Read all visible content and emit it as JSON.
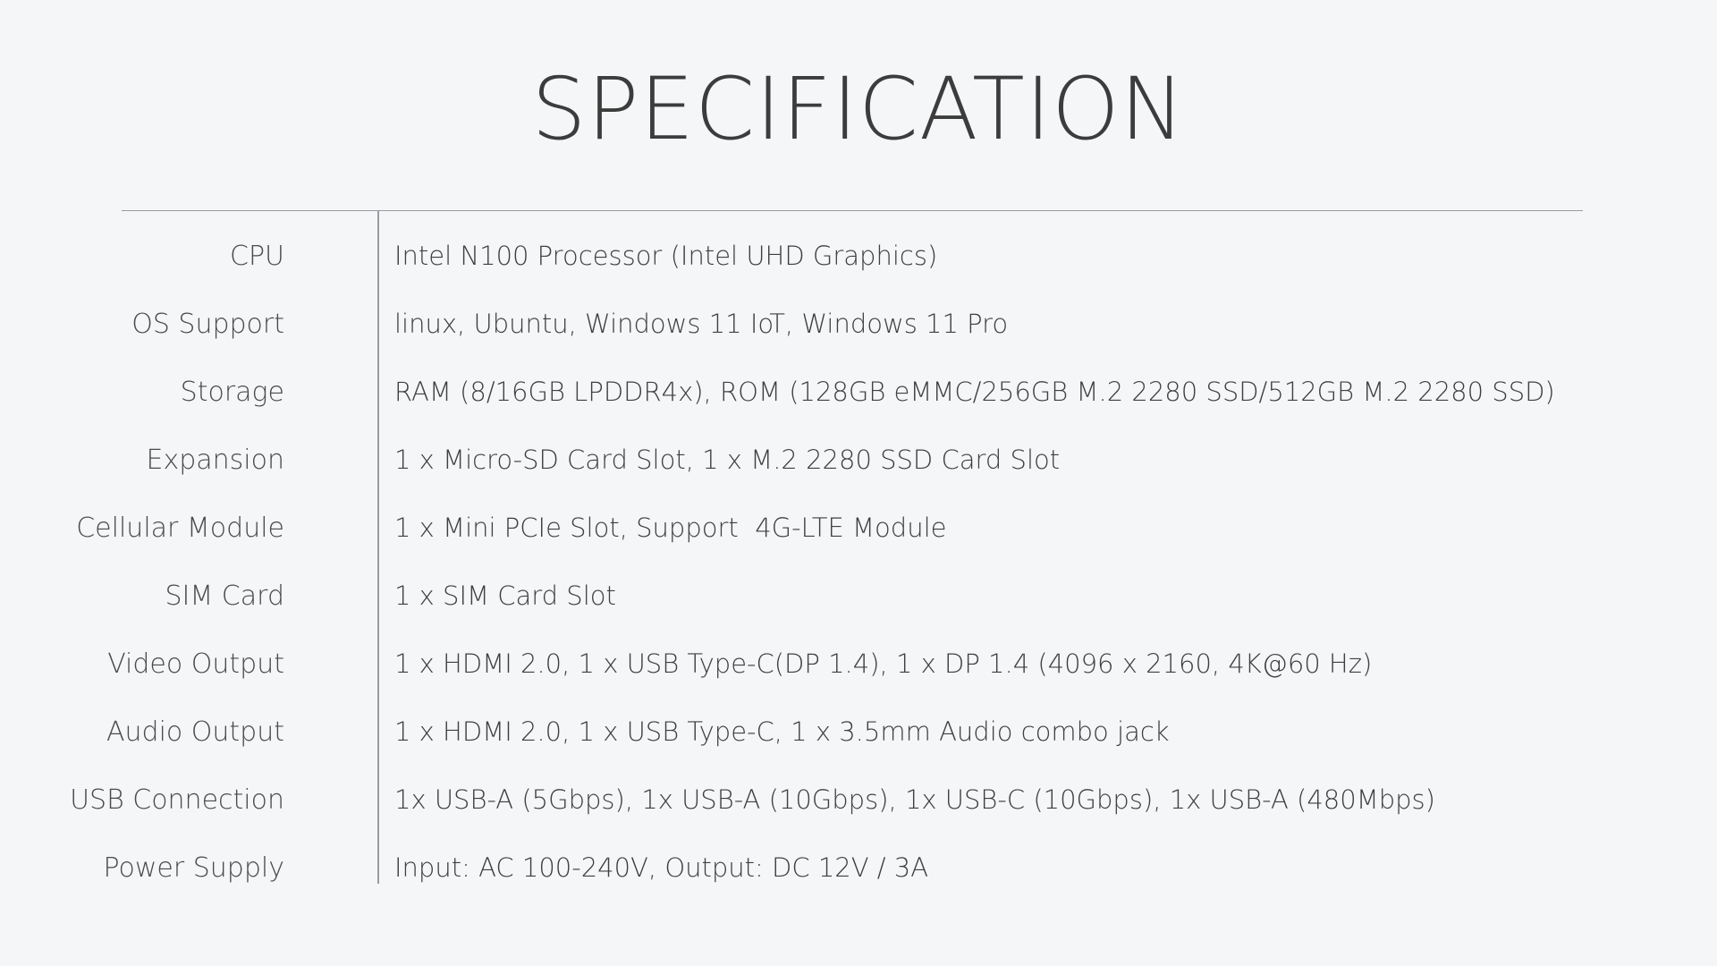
{
  "document": {
    "title": "SPECIFICATION",
    "accent_line_color": "#9a9ba0",
    "background_color": "#f5f6f7",
    "text_color": "#3f3f43"
  },
  "spec": {
    "rows": [
      {
        "label": "CPU",
        "value": "Intel N100 Processor (Intel UHD Graphics)"
      },
      {
        "label": "OS Support",
        "value": "linux, Ubuntu, Windows 11 IoT, Windows 11 Pro"
      },
      {
        "label": "Storage",
        "value": "RAM (8/16GB LPDDR4x), ROM (128GB eMMC/256GB M.2 2280 SSD/512GB M.2 2280 SSD)"
      },
      {
        "label": "Expansion",
        "value": "1 x Micro-SD Card Slot, 1 x M.2 2280 SSD Card Slot"
      },
      {
        "label": "Cellular Module",
        "value": "1 x Mini PCIe Slot, Support  4G-LTE Module"
      },
      {
        "label": "SIM Card",
        "value": "1 x SIM Card Slot"
      },
      {
        "label": "Video Output",
        "value": "1 x HDMI 2.0, 1 x USB Type-C(DP 1.4), 1 x DP 1.4 (4096 x 2160, 4K@60 Hz)"
      },
      {
        "label": "Audio Output",
        "value": "1 x HDMI 2.0, 1 x USB Type-C, 1 x 3.5mm Audio combo jack"
      },
      {
        "label": "USB Connection",
        "value": "1x USB-A (5Gbps), 1x USB-A (10Gbps), 1x USB-C (10Gbps), 1x USB-A (480Mbps)"
      },
      {
        "label": "Power Supply",
        "value": "Input: AC 100-240V, Output: DC 12V / 3A"
      }
    ]
  }
}
